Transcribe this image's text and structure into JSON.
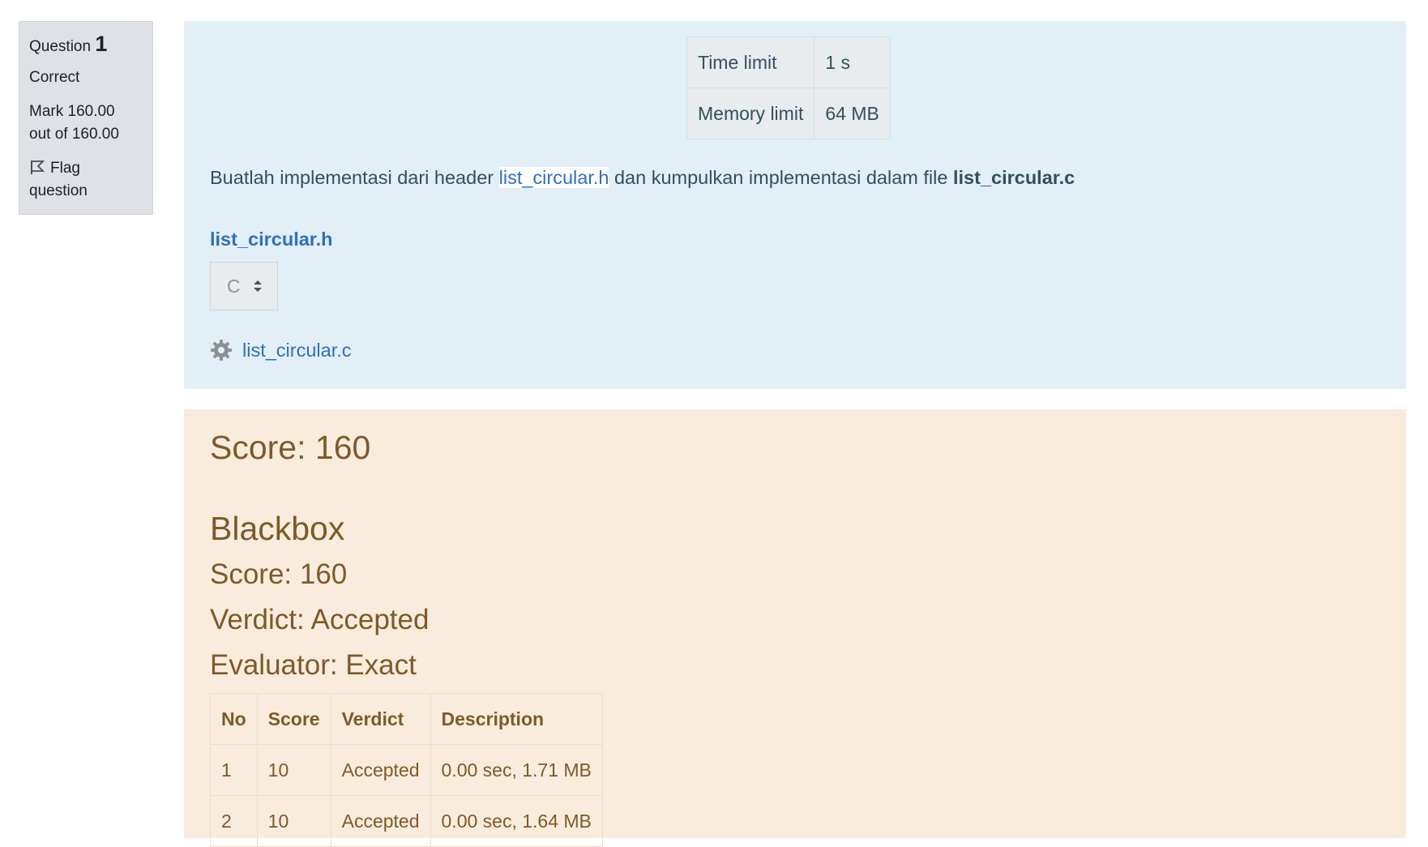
{
  "question_info": {
    "label": "Question",
    "number": "1",
    "state": "Correct",
    "grade_line1": "Mark 160.00",
    "grade_line2": "out of 160.00",
    "flag_label_line1": "Flag",
    "flag_label_line2": "question",
    "flag_icon": "flag-icon"
  },
  "limits": [
    {
      "label": "Time limit",
      "value": "1 s"
    },
    {
      "label": "Memory limit",
      "value": "64 MB"
    }
  ],
  "intro": {
    "prefix": "Buatlah implementasi dari header",
    "header_link": "list_circular.h",
    "middle": "dan kumpulkan implementasi dalam file",
    "file_name": "list_circular.c"
  },
  "header_file_link": "list_circular.h",
  "language_select": {
    "selected": "C"
  },
  "answer_file": {
    "name": "list_circular.c",
    "icon": "gear-icon"
  },
  "feedback": {
    "score": "Score: 160",
    "section_title": "Blackbox",
    "section_score": "Score: 160",
    "verdict": "Verdict: Accepted",
    "evaluator": "Evaluator: Exact",
    "table": {
      "headers": [
        "No",
        "Score",
        "Verdict",
        "Description"
      ],
      "rows": [
        [
          "1",
          "10",
          "Accepted",
          "0.00 sec, 1.71 MB"
        ],
        [
          "2",
          "10",
          "Accepted",
          "0.00 sec, 1.64 MB"
        ]
      ]
    }
  },
  "colors": {
    "formulation_bg": "#e2eff6",
    "feedback_bg": "#f9ecdd",
    "feedback_text": "#7d5a29",
    "link": "#2f6fbd"
  }
}
